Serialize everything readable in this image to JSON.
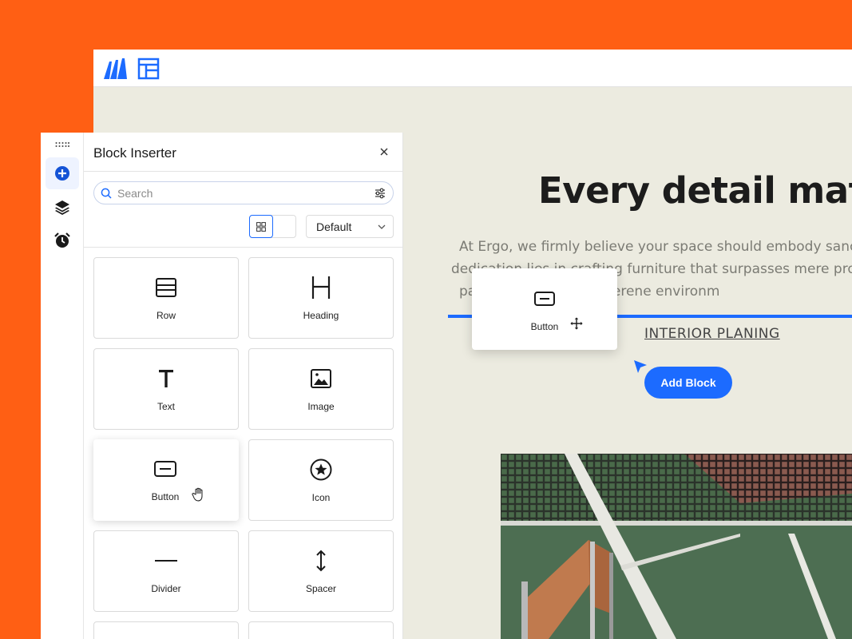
{
  "canvas": {
    "headline": "Every detail matte",
    "paragraph_lines": [
      "At Ergo, we firmly believe your space should embody sanctuar",
      "dedication lies in crafting furniture that surpasses mere props. I",
      "part of fostering that serene environm"
    ],
    "link_text": "INTERIOR PLANING",
    "add_block_label": "Add Block",
    "dragged_block_label": "Button"
  },
  "rail": {
    "items": [
      "add-block",
      "layers",
      "history"
    ]
  },
  "panel": {
    "title": "Block Inserter",
    "search_placeholder": "Search",
    "sort_value": "Default",
    "tiles": [
      {
        "label": "Row",
        "icon": "row-icon"
      },
      {
        "label": "Heading",
        "icon": "heading-icon"
      },
      {
        "label": "Text",
        "icon": "text-icon"
      },
      {
        "label": "Image",
        "icon": "image-icon"
      },
      {
        "label": "Button",
        "icon": "button-icon"
      },
      {
        "label": "Icon",
        "icon": "star-icon"
      },
      {
        "label": "Divider",
        "icon": "divider-icon"
      },
      {
        "label": "Spacer",
        "icon": "spacer-icon"
      }
    ]
  },
  "colors": {
    "background": "#ff5f14",
    "accent": "#1c6bff",
    "canvas": "#ecebe0"
  }
}
